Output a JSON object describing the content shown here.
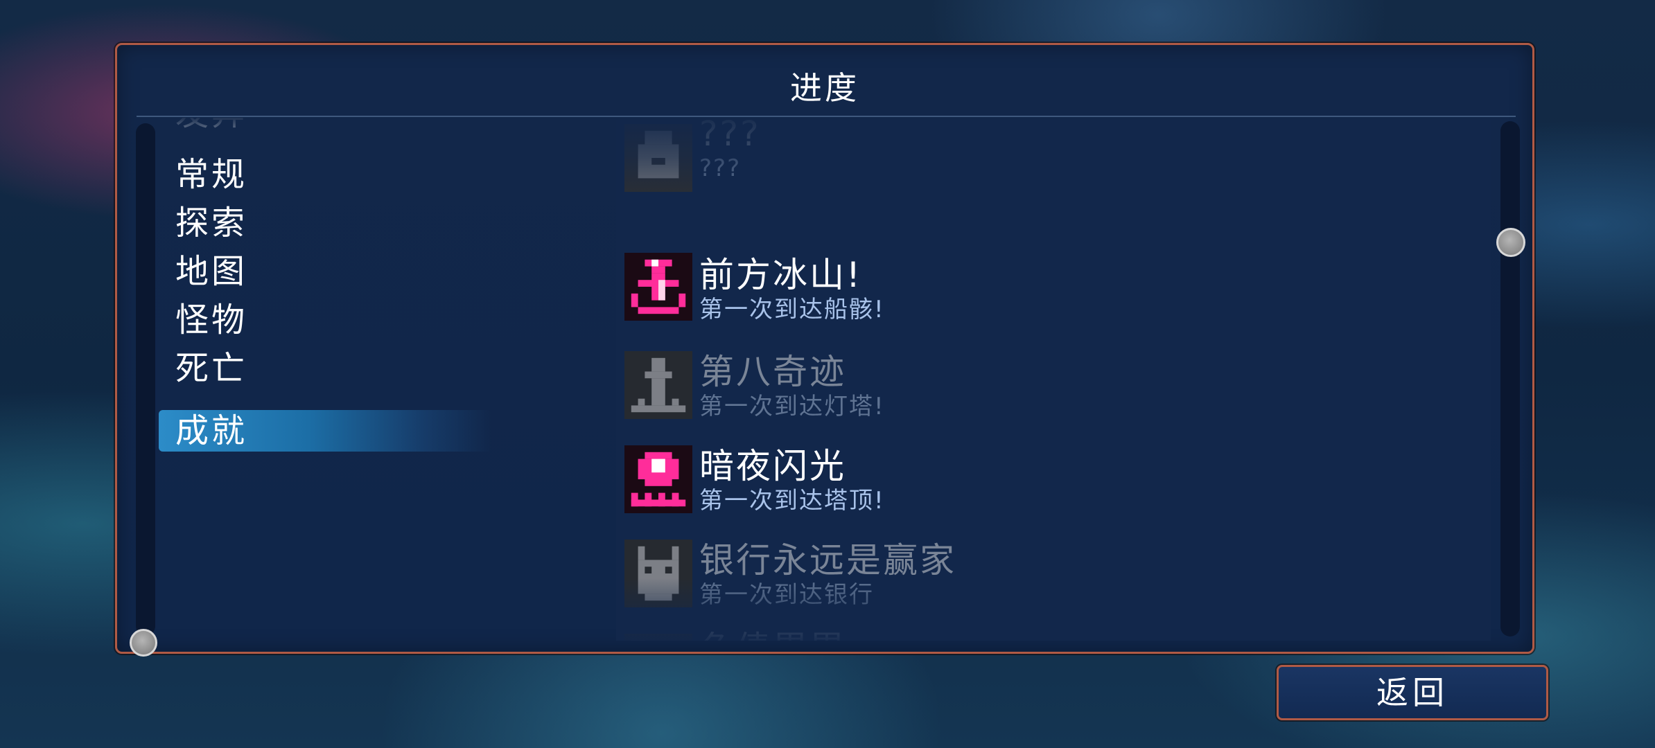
{
  "panel": {
    "title": "进度"
  },
  "categories": [
    {
      "label": "发异",
      "state": "partially-scrolled"
    },
    {
      "label": "常规",
      "state": "normal"
    },
    {
      "label": "探索",
      "state": "normal"
    },
    {
      "label": "地图",
      "state": "normal"
    },
    {
      "label": "怪物",
      "state": "normal"
    },
    {
      "label": "死亡",
      "state": "normal"
    },
    {
      "label": "成就",
      "state": "selected"
    }
  ],
  "achievements": [
    {
      "title": "???",
      "desc": "???",
      "unlocked": false,
      "icon": "locked-chest-icon"
    },
    {
      "title": "前方冰山!",
      "desc": "第一次到达船骸!",
      "unlocked": true,
      "icon": "anchor-icon"
    },
    {
      "title": "第八奇迹",
      "desc": "第一次到达灯塔!",
      "unlocked": false,
      "icon": "lighthouse-icon"
    },
    {
      "title": "暗夜闪光",
      "desc": "第一次到达塔顶!",
      "unlocked": true,
      "icon": "glowing-orb-icon"
    },
    {
      "title": "银行永远是赢家",
      "desc": "第一次到达银行",
      "unlocked": false,
      "icon": "bank-mask-icon"
    },
    {
      "title": "负债累累",
      "desc": "",
      "unlocked": false,
      "icon": "debt-icon"
    }
  ],
  "buttons": {
    "back_label": "返回"
  },
  "colors": {
    "panel_border": "#b05a45",
    "panel_bg": "#12274a",
    "selected_highlight": "#2c8cc8",
    "unlocked_icon": "#e0157a",
    "desc_text": "#a9c3ea"
  }
}
